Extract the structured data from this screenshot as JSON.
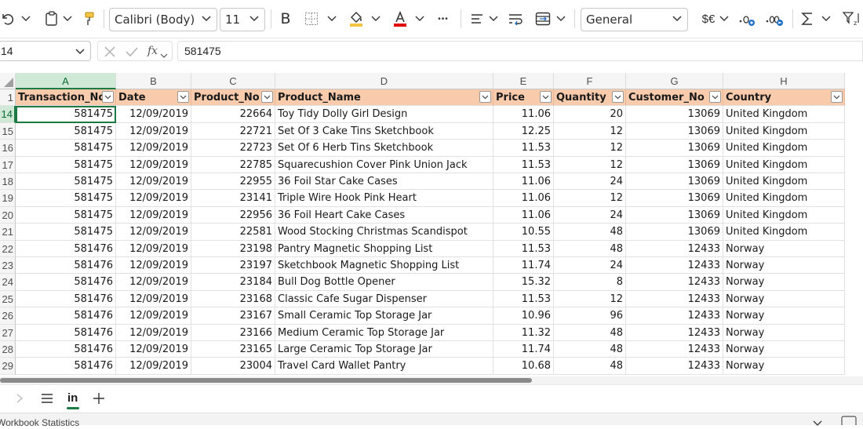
{
  "toolbar": {
    "font_name": "Calibri (Body)",
    "font_size": "11",
    "number_format": "General",
    "bold_label": "B",
    "more_label": "•••",
    "currency_label": "$€",
    "fill_color": "#f4c542",
    "font_color": "#e00000"
  },
  "formula_bar": {
    "name_box": "14",
    "fx_label": "fx",
    "value": "581475"
  },
  "columns": [
    "A",
    "B",
    "C",
    "D",
    "E",
    "F",
    "G",
    "H"
  ],
  "headers": [
    "Transaction_No",
    "Date",
    "Product_No",
    "Product_Name",
    "Price",
    "Quantity",
    "Customer_No",
    "Country"
  ],
  "header_row_number": "1",
  "rows": [
    {
      "n": "14",
      "c": [
        "581475",
        "12/09/2019",
        "22664",
        "Toy Tidy Dolly Girl Design",
        "11.06",
        "20",
        "13069",
        "United Kingdom"
      ]
    },
    {
      "n": "15",
      "c": [
        "581475",
        "12/09/2019",
        "22721",
        "Set Of 3 Cake Tins Sketchbook",
        "12.25",
        "12",
        "13069",
        "United Kingdom"
      ]
    },
    {
      "n": "16",
      "c": [
        "581475",
        "12/09/2019",
        "22723",
        "Set Of 6 Herb Tins Sketchbook",
        "11.53",
        "12",
        "13069",
        "United Kingdom"
      ]
    },
    {
      "n": "17",
      "c": [
        "581475",
        "12/09/2019",
        "22785",
        "Squarecushion Cover Pink Union Jack",
        "11.53",
        "12",
        "13069",
        "United Kingdom"
      ]
    },
    {
      "n": "18",
      "c": [
        "581475",
        "12/09/2019",
        "22955",
        "36 Foil Star Cake Cases",
        "11.06",
        "24",
        "13069",
        "United Kingdom"
      ]
    },
    {
      "n": "19",
      "c": [
        "581475",
        "12/09/2019",
        "23141",
        "Triple Wire Hook Pink Heart",
        "11.06",
        "12",
        "13069",
        "United Kingdom"
      ]
    },
    {
      "n": "20",
      "c": [
        "581475",
        "12/09/2019",
        "22956",
        "36 Foil Heart Cake Cases",
        "11.06",
        "24",
        "13069",
        "United Kingdom"
      ]
    },
    {
      "n": "21",
      "c": [
        "581475",
        "12/09/2019",
        "22581",
        "Wood Stocking Christmas Scandispot",
        "10.55",
        "48",
        "13069",
        "United Kingdom"
      ]
    },
    {
      "n": "22",
      "c": [
        "581476",
        "12/09/2019",
        "23198",
        "Pantry Magnetic Shopping List",
        "11.53",
        "48",
        "12433",
        "Norway"
      ]
    },
    {
      "n": "23",
      "c": [
        "581476",
        "12/09/2019",
        "23197",
        "Sketchbook Magnetic Shopping List",
        "11.74",
        "24",
        "12433",
        "Norway"
      ]
    },
    {
      "n": "24",
      "c": [
        "581476",
        "12/09/2019",
        "23184",
        "Bull Dog Bottle Opener",
        "15.32",
        "8",
        "12433",
        "Norway"
      ]
    },
    {
      "n": "25",
      "c": [
        "581476",
        "12/09/2019",
        "23168",
        "Classic Cafe Sugar Dispenser",
        "11.53",
        "12",
        "12433",
        "Norway"
      ]
    },
    {
      "n": "26",
      "c": [
        "581476",
        "12/09/2019",
        "23167",
        "Small Ceramic Top Storage Jar",
        "10.96",
        "96",
        "12433",
        "Norway"
      ]
    },
    {
      "n": "27",
      "c": [
        "581476",
        "12/09/2019",
        "23166",
        "Medium Ceramic Top Storage Jar",
        "11.32",
        "48",
        "12433",
        "Norway"
      ]
    },
    {
      "n": "28",
      "c": [
        "581476",
        "12/09/2019",
        "23165",
        "Large Ceramic Top Storage Jar",
        "11.74",
        "48",
        "12433",
        "Norway"
      ]
    },
    {
      "n": "29",
      "c": [
        "581476",
        "12/09/2019",
        "23004",
        "Travel Card Wallet Pantry",
        "10.68",
        "48",
        "12433",
        "Norway"
      ]
    }
  ],
  "sheet_tabs": [
    {
      "label": "in"
    }
  ],
  "status_bar": {
    "text": "Workbook Statistics"
  }
}
